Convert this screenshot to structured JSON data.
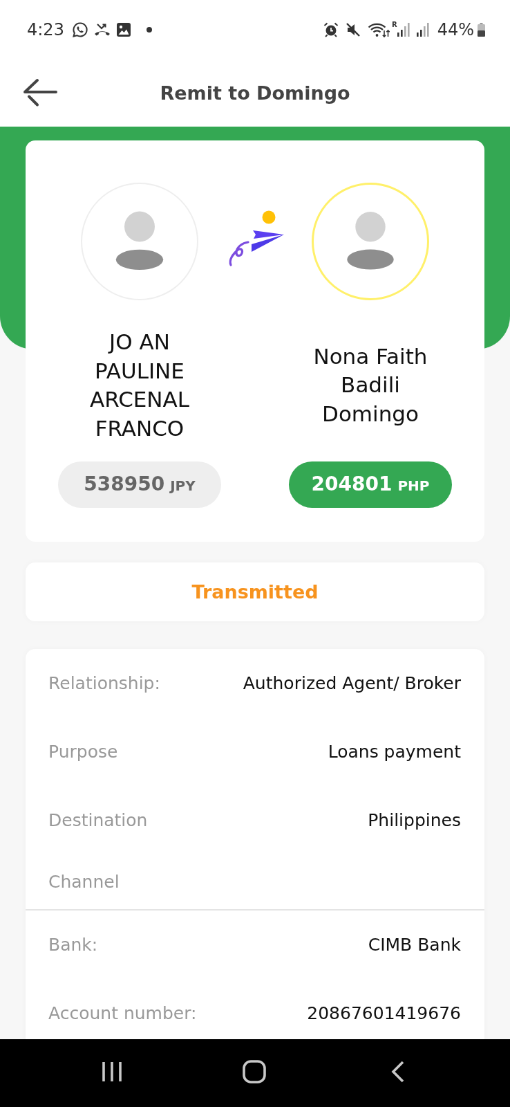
{
  "status_bar": {
    "time": "4:23",
    "roaming": "R",
    "battery": "44%"
  },
  "header": {
    "title": "Remit to Domingo"
  },
  "parties": [
    {
      "kind": "sender",
      "name": "JO AN PAULINE ARCENAL FRANCO",
      "amount": "538950",
      "currency": "JPY"
    },
    {
      "kind": "recipient",
      "name": "Nona Faith Badili Domingo",
      "amount": "204801",
      "currency": "PHP"
    }
  ],
  "transfer_status": "Transmitted",
  "details": [
    {
      "label": "Relationship:",
      "value": "Authorized Agent/ Broker"
    },
    {
      "label": "Purpose",
      "value": "Loans payment"
    },
    {
      "label": "Destination",
      "value": "Philippines"
    }
  ],
  "channel": {
    "heading": "Channel",
    "rows": [
      {
        "label": "Bank:",
        "value": "CIMB Bank"
      },
      {
        "label": "Account number:",
        "value": "20867601419676"
      }
    ]
  }
}
